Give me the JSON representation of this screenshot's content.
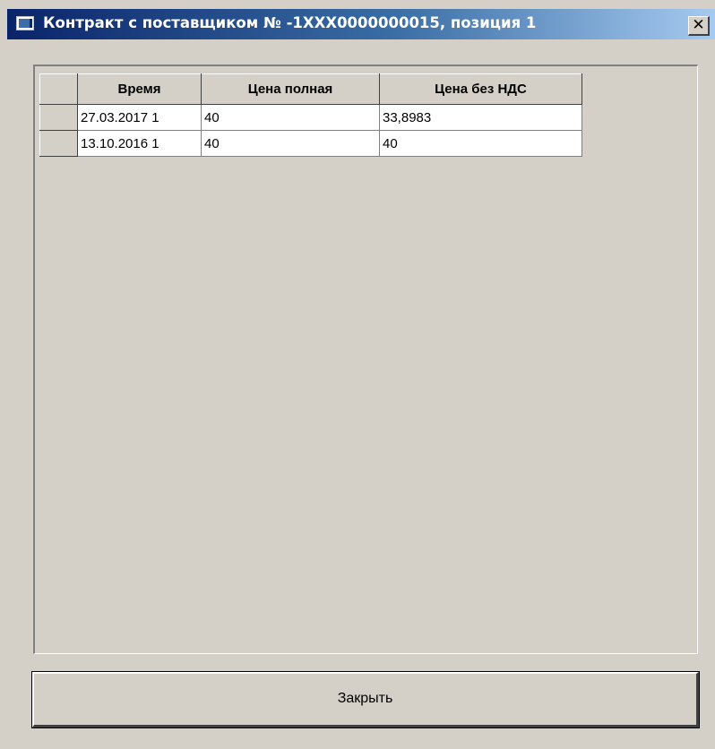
{
  "window": {
    "title": "Контракт с поставщиком № -1XXX0000000015, позиция 1",
    "close_glyph": "✕",
    "title_icon": "window-app-icon"
  },
  "grid": {
    "columns": [
      "Время",
      "Цена полная",
      "Цена без НДС"
    ],
    "rows": [
      {
        "time": "27.03.2017 1",
        "price_full": "40",
        "price_no_vat": "33,8983"
      },
      {
        "time": "13.10.2016 1",
        "price_full": "40",
        "price_no_vat": "40"
      }
    ]
  },
  "footer": {
    "close_label": "Закрыть"
  },
  "colors": {
    "window_bg": "#d4d0c8",
    "titlebar_start": "#0a246a",
    "titlebar_end": "#a6caf0",
    "cell_bg": "#ffffff"
  }
}
